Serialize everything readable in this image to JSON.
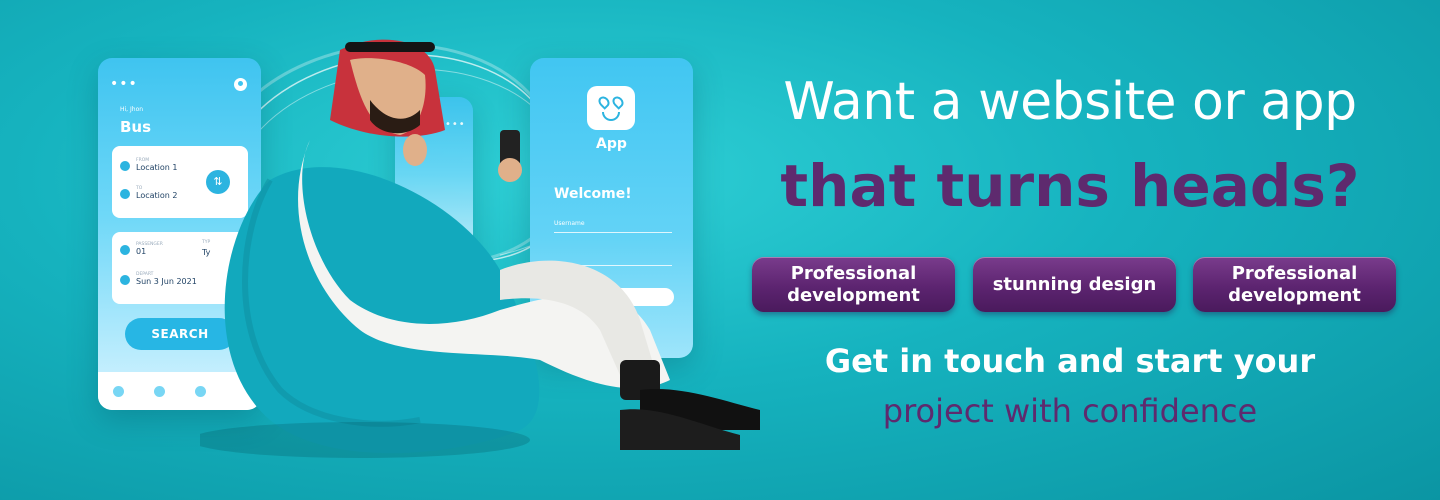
{
  "colors": {
    "background": "#16b3bf",
    "accent_purple": "#5e2a6e",
    "headline_white": "#ffffff",
    "phone_blue": "#3fc4f0"
  },
  "phone_left": {
    "menu_icon": "ellipsis-icon",
    "greeting": "Hi, Jhon",
    "title": "Bus",
    "from_label": "FROM",
    "from_value": "Location 1",
    "to_label": "TO",
    "to_value": "Location 2",
    "passenger_label": "PASSENGER",
    "passenger_value": "01",
    "type_label": "TYP",
    "type_value": "Ty",
    "depart_label": "DEPART",
    "depart_value": "Sun 3 Jun 2021",
    "search_label": "SEARCH"
  },
  "phone_right": {
    "app_name": "App",
    "welcome": "Welcome!",
    "username_label": "Username"
  },
  "headline": {
    "line1": "Want a website or app",
    "line2": "that turns heads?"
  },
  "pills": [
    {
      "label": "Professional development"
    },
    {
      "label": "stunning design"
    },
    {
      "label": "Professional development"
    }
  ],
  "cta": {
    "line1": "Get in touch and start your",
    "line2": "project with confidence"
  }
}
